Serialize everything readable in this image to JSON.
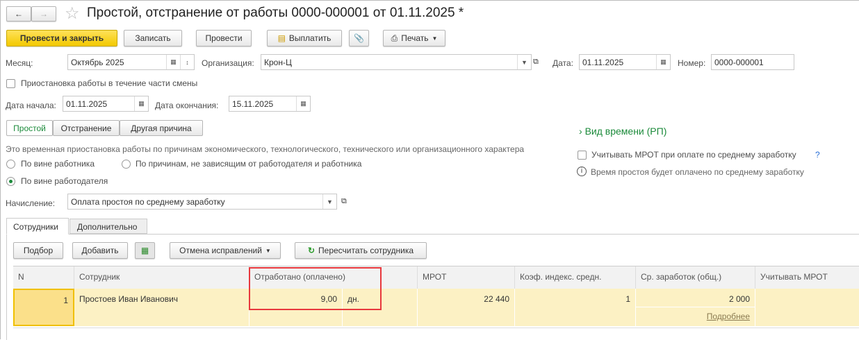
{
  "window": {
    "title": "Простой, отстранение от работы 0000-000001 от 01.11.2025 *"
  },
  "toolbar": {
    "post_close": "Провести и закрыть",
    "save": "Записать",
    "post": "Провести",
    "pay": "Выплатить",
    "print": "Печать"
  },
  "form": {
    "month_label": "Месяц:",
    "month_value": "Октябрь 2025",
    "org_label": "Организация:",
    "org_value": "Крон-Ц",
    "date_label": "Дата:",
    "date_value": "01.11.2025",
    "number_label": "Номер:",
    "number_value": "0000-000001",
    "partial_shift_label": "Приостановка работы в течение части смены",
    "partial_shift_checked": false,
    "start_label": "Дата начала:",
    "start_value": "01.11.2025",
    "end_label": "Дата окончания:",
    "end_value": "15.11.2025",
    "kind_tabs": [
      "Простой",
      "Отстранение",
      "Другая причина"
    ],
    "kind_selected": 0,
    "description": "Это временная приостановка работы по причинам экономического, технологического, технического или организационного характера",
    "reasons": [
      "По вине работника",
      "По причинам, не зависящим от работодателя и работника",
      "По вине работодателя"
    ],
    "reason_selected": 2,
    "accrual_label": "Начисление:",
    "accrual_value": "Оплата простоя по среднему заработку",
    "time_kind": "Вид времени (РП)",
    "mrot_label": "Учитывать МРОТ при оплате по среднему заработку",
    "mrot_checked": false,
    "help": "?",
    "info": "Время простоя будет оплачено по среднему заработку"
  },
  "tabs": [
    "Сотрудники",
    "Дополнительно"
  ],
  "table_toolbar": {
    "pick": "Подбор",
    "add": "Добавить",
    "cancel_fix": "Отмена исправлений",
    "recalc": "Пересчитать сотрудника"
  },
  "table": {
    "headers": [
      "N",
      "Сотрудник",
      "Отработано (оплачено)",
      "МРОТ",
      "Коэф. индекс. средн.",
      "Ср. заработок (общ.)",
      "Учитывать МРОТ"
    ],
    "rows": [
      {
        "n": "1",
        "employee": "Простоев Иван Иванович",
        "worked": "9,00",
        "unit": "дн.",
        "mrot": "22 440",
        "coef": "1",
        "avg": "2 000",
        "details": "Подробнее"
      }
    ]
  },
  "colors": {
    "accent": "#f3c900",
    "green": "#1b8a3a",
    "highlight": "#e8383d"
  }
}
